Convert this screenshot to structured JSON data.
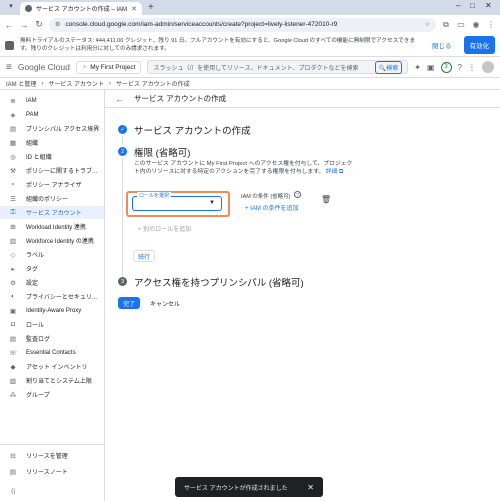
{
  "browser": {
    "tab_title": "サービス アカウントの作成 – IAM と...",
    "url": "console.cloud.google.com/iam-admin/serviceaccounts/create?project=lively-listener-472010-r9"
  },
  "banner": {
    "text": "無料トライアルのステータス: ¥44,411.00 クレジット、残り 91 日。フルアカウントを有効にすると、Google Cloud のすべての機能に無制限でアクセスできます。残りのクレジットは利用分に対してのみ請求されます。",
    "close_label": "閉じる",
    "activate_label": "有効化"
  },
  "header": {
    "logo_text": "Google Cloud",
    "project_name": "My First Project",
    "search_placeholder": "スラッシュ（/）を使用してリソース、ドキュメント、プロダクトなどを検索",
    "search_button": "検索",
    "notification_count": "3"
  },
  "breadcrumb": {
    "items": [
      "IAM と管理",
      "サービス アカウント",
      "サービス アカウントの作成"
    ]
  },
  "sidebar": {
    "items": [
      {
        "label": "IAM",
        "icon": "person-add-icon"
      },
      {
        "label": "PAM",
        "icon": "shield-icon"
      },
      {
        "label": "プリンシパル アクセス境界",
        "icon": "boundary-icon"
      },
      {
        "label": "組織",
        "icon": "building-icon"
      },
      {
        "label": "ID と組織",
        "icon": "id-icon"
      },
      {
        "label": "ポリシーに関するトラブ...",
        "icon": "wrench-icon"
      },
      {
        "label": "ポリシー アナライザ",
        "icon": "search-icon"
      },
      {
        "label": "組織のポリシー",
        "icon": "list-icon"
      },
      {
        "label": "サービス アカウント",
        "icon": "key-icon"
      },
      {
        "label": "Workload Identity 連携",
        "icon": "link-icon"
      },
      {
        "label": "Workforce Identity の連携",
        "icon": "people-icon"
      },
      {
        "label": "ラベル",
        "icon": "label-icon"
      },
      {
        "label": "タグ",
        "icon": "tag-icon"
      },
      {
        "label": "設定",
        "icon": "gear-icon"
      },
      {
        "label": "プライバシーとセキュリ...",
        "icon": "lock-icon"
      },
      {
        "label": "Identity-Aware Proxy",
        "icon": "proxy-icon"
      },
      {
        "label": "ロール",
        "icon": "role-icon"
      },
      {
        "label": "監査ログ",
        "icon": "log-icon"
      },
      {
        "label": "Essential Contacts",
        "icon": "contact-icon"
      },
      {
        "label": "アセット インベントリ",
        "icon": "inventory-icon"
      },
      {
        "label": "割り当てとシステム上限",
        "icon": "quota-icon"
      },
      {
        "label": "グループ",
        "icon": "group-icon"
      }
    ],
    "bottom_items": [
      {
        "label": "リリースを管理",
        "icon": "cart-icon"
      },
      {
        "label": "リリースノート",
        "icon": "notes-icon"
      }
    ]
  },
  "main": {
    "page_title": "サービス アカウントの作成",
    "step1_title": "サービス アカウントの作成",
    "step2_title": "権限 (省略可)",
    "step2_number": "2",
    "step2_desc": "このサービス アカウントに My First Project へのアクセス権を付与して、プロジェクト内のリソースに対する特定のアクションを完了する権限を付与します。",
    "learn_more": "詳細",
    "role_label": "ロールを選択",
    "condition_label": "IAM の条件 (省略可)",
    "add_condition": "IAM の条件を追加",
    "add_another_role": "別のロールを追加",
    "continue_label": "続行",
    "step3_title": "アクセス権を持つプリンシパル (省略可)",
    "step3_number": "3",
    "done_label": "完了",
    "cancel_label": "キャンセル"
  },
  "toast": {
    "text": "サービス アカウントが作成されました"
  }
}
